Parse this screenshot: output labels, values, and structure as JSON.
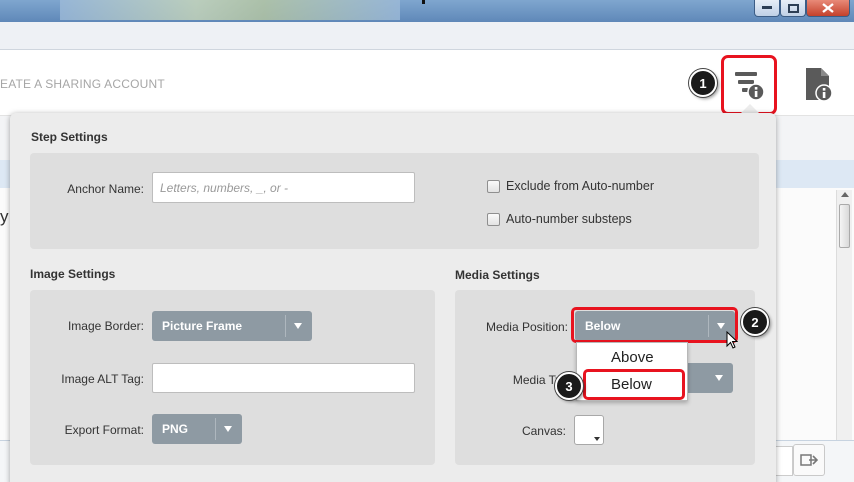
{
  "header": {
    "share_text": "EATE A SHARING ACCOUNT"
  },
  "popup": {
    "step_settings": {
      "title": "Step Settings",
      "anchor_label": "Anchor Name:",
      "anchor_placeholder": "Letters, numbers, _, or -",
      "exclude_label": "Exclude from Auto-number",
      "substeps_label": "Auto-number substeps"
    },
    "image_settings": {
      "title": "Image Settings",
      "border_label": "Image Border:",
      "border_value": "Picture Frame",
      "alt_label": "Image ALT Tag:",
      "alt_value": "",
      "format_label": "Export Format:",
      "format_value": "PNG"
    },
    "media_settings": {
      "title": "Media Settings",
      "position_label": "Media Position:",
      "position_value": "Below",
      "type_label": "Media Typ",
      "canvas_label": "Canvas:",
      "options": [
        "Above",
        "Below"
      ]
    }
  },
  "callouts": [
    "1",
    "2",
    "3"
  ],
  "icons": {
    "settings": "step-settings-icon",
    "info": "document-info-icon",
    "send": "send-arrow-icon"
  },
  "colors": {
    "highlight": "#e8131f",
    "select_bg": "#8e9aa3"
  }
}
